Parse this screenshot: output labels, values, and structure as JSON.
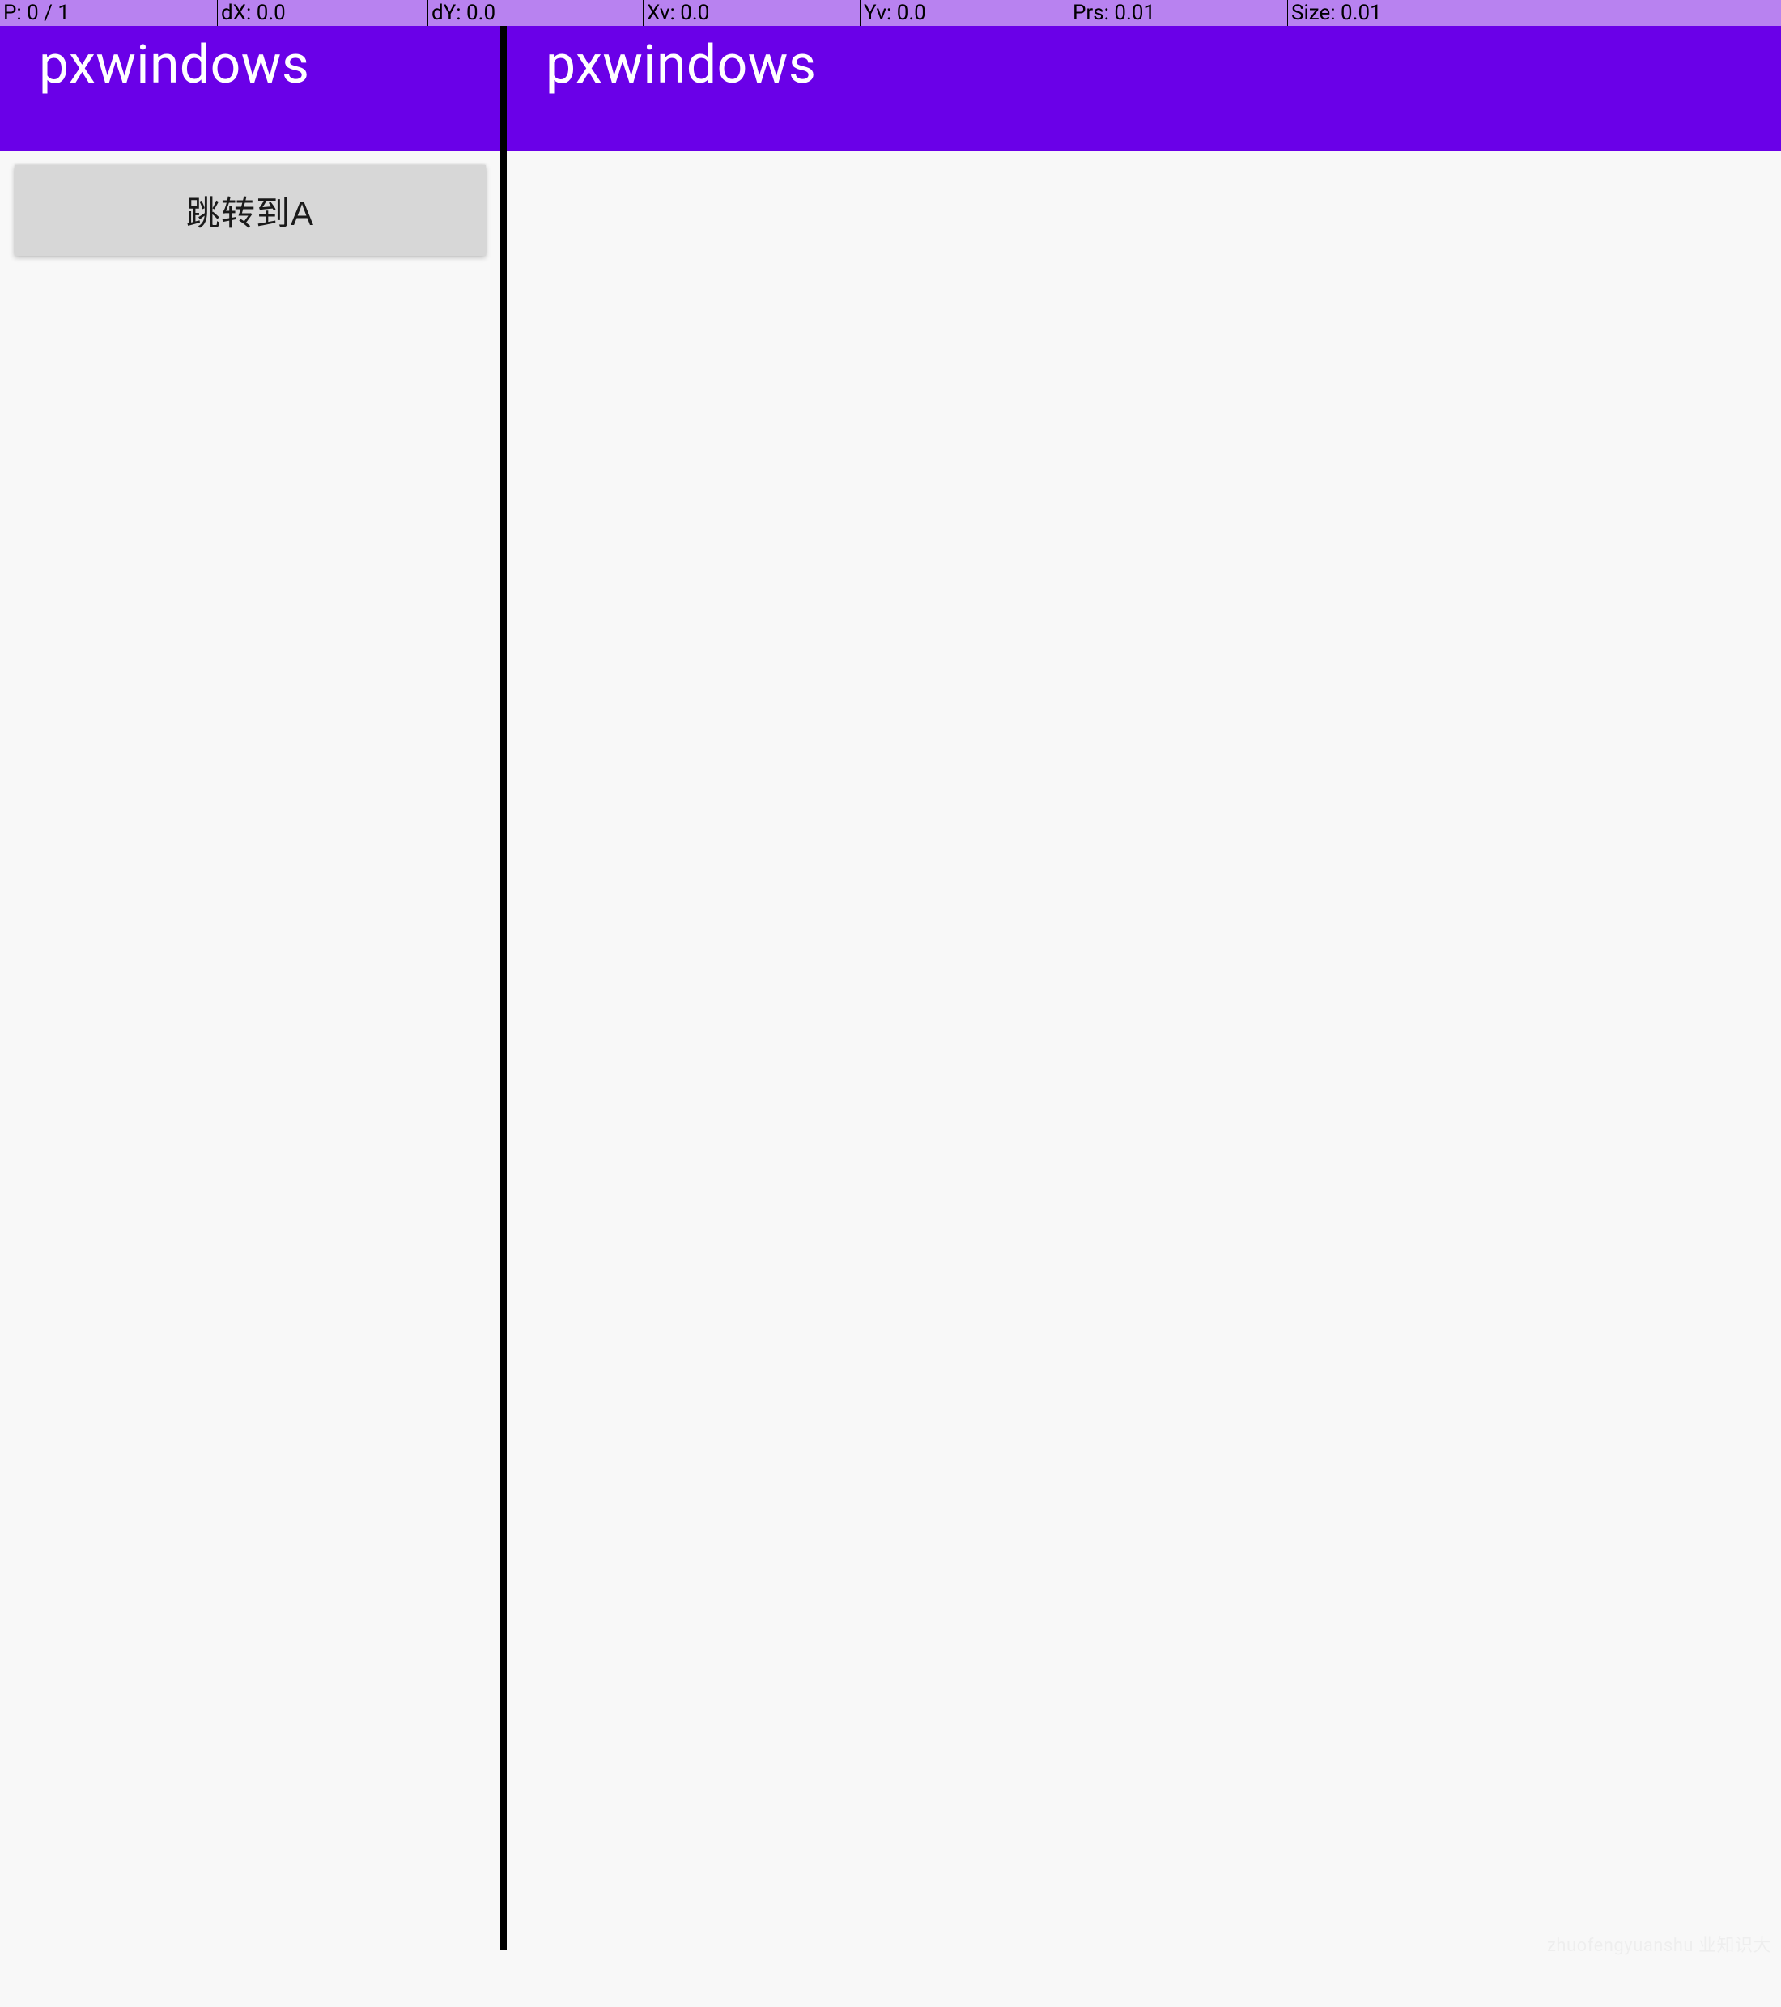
{
  "debug_bar": {
    "p": "P: 0 / 1",
    "dx": "dX: 0.0",
    "dy": "dY: 0.0",
    "xv": "Xv: 0.0",
    "yv": "Yv: 0.0",
    "prs": "Prs: 0.01",
    "size": "Size: 0.01"
  },
  "left_pane": {
    "toolbar_title": "pxwindows",
    "button_label": "跳转到A"
  },
  "right_pane": {
    "toolbar_title": "pxwindows"
  },
  "watermark": "zhuofengyuanshu 业知识大"
}
